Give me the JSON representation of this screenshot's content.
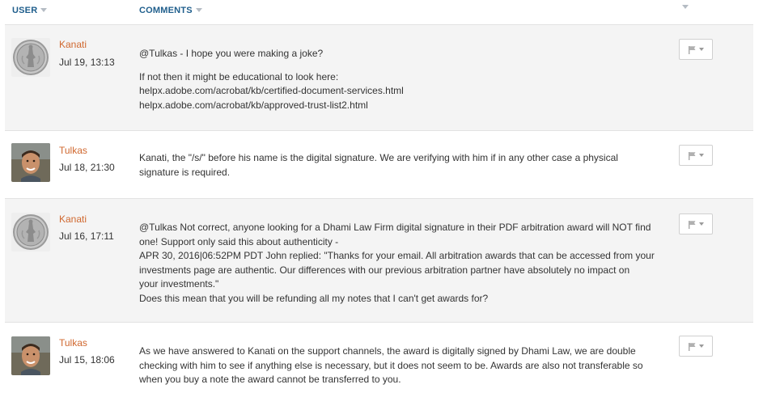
{
  "header": {
    "user_label": "USER",
    "comments_label": "COMMENTS"
  },
  "comments": [
    {
      "user": "Kanati",
      "date": "Jul 19, 13:13",
      "avatar": "coin-avatar",
      "paragraphs": [
        [
          "@Tulkas - I hope you were making a joke?"
        ],
        [
          "If not then it might be educational to look here:",
          "helpx.adobe.com/acrobat/kb/certified-document-services.html",
          "helpx.adobe.com/acrobat/kb/approved-trust-list2.html"
        ]
      ]
    },
    {
      "user": "Tulkas",
      "date": "Jul 18, 21:30",
      "avatar": "person-avatar",
      "paragraphs": [
        [
          "Kanati, the \"/s/\" before his name is the digital signature. We are verifying with him if in any other case a physical",
          "signature is required."
        ]
      ]
    },
    {
      "user": "Kanati",
      "date": "Jul 16, 17:11",
      "avatar": "coin-avatar",
      "paragraphs": [
        [
          "@Tulkas Not correct, anyone looking for a Dhami Law Firm digital signature in their PDF arbitration award will NOT find",
          "one! Support only said this about authenticity -",
          "APR 30, 2016|06:52PM PDT John replied: \"Thanks for your email. All arbitration awards that can be accessed from your",
          "investments page are authentic. Our differences with our previous arbitration partner have absolutely no impact on",
          "your investments.\"",
          "Does this mean that you will be refunding all my notes that I can't get awards for?"
        ]
      ]
    },
    {
      "user": "Tulkas",
      "date": "Jul 15, 18:06",
      "avatar": "person-avatar",
      "paragraphs": [
        [
          "As we have answered to Kanati on the support channels, the award is digitally signed by Dhami Law, we are double",
          "checking with him to see if anything else is necessary, but it does not seem to be. Awards are also not transferable so",
          "when you buy a note the award cannot be transferred to you."
        ]
      ]
    }
  ],
  "icons": {
    "flag": "flag-icon",
    "sort": "sort-caret-icon"
  },
  "colors": {
    "header_text": "#1f5e8c",
    "username": "#d0682f",
    "row_shaded": "#f4f4f4"
  }
}
